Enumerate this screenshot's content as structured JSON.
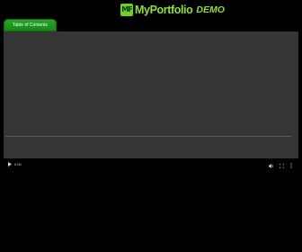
{
  "header": {
    "logo_mark": "MF",
    "logo_text": "MyPortfolio",
    "logo_badge": "DEMO"
  },
  "toc": {
    "label": "Table of Contents"
  },
  "player": {
    "time": "0:00",
    "progress": 0,
    "icons": {
      "play": "play-icon",
      "volume": "volume-icon",
      "fullscreen": "fullscreen-icon",
      "menu": "more-vertical-icon"
    }
  },
  "colors": {
    "brand_green": "#8be03f",
    "toc_green": "#1f9a1f",
    "video_bg": "#353535"
  }
}
